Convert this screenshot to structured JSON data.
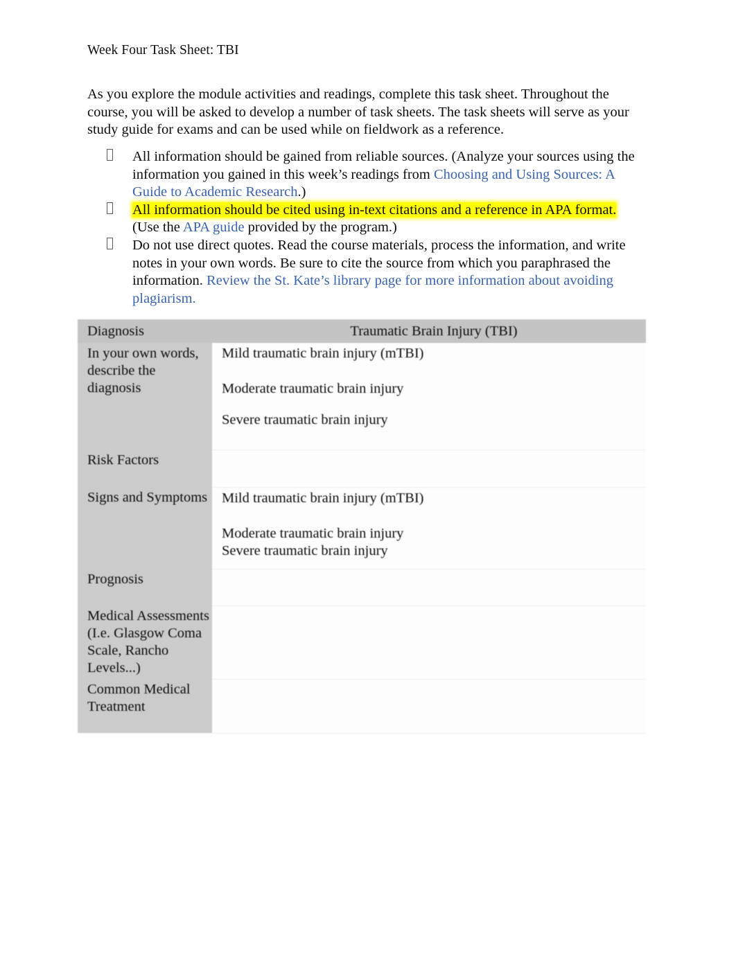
{
  "document": {
    "header": "Week Four Task Sheet: TBI",
    "intro": "As you explore the module activities and readings, complete this task sheet. Throughout the course, you will be asked to develop a number of task sheets. The task sheets will serve as your study guide for exams and can be used while on fieldwork as a reference.",
    "bullet_marker_glyph": "missing-glyph-box"
  },
  "instructions": [
    {
      "id": "reliable-sources",
      "part1": "All information should be gained from reliable sources. (Analyze your sources using the information you gained in this week’s readings from ",
      "link": "Choosing and Using Sources: A Guide to Academic Research",
      "part2": ".)",
      "highlighted": false
    },
    {
      "id": "apa-citations",
      "highlighted_text": "All information should be cited using in-text citations and a reference in APA format.",
      "part1": " (Use the ",
      "link": "APA guide",
      "part2": " provided by the program.)",
      "highlighted": true
    },
    {
      "id": "no-direct-quotes",
      "part1": "Do not use direct quotes. Read the course materials, process the information, and write notes in your own words. Be sure to cite the source from which you paraphrased the information. ",
      "link": "Review the St. Kate’s library page for more information about avoiding plagiarism.",
      "part2": "",
      "highlighted": false
    }
  ],
  "table": {
    "header": {
      "col1": "Diagnosis",
      "col2": "Traumatic Brain Injury (TBI)"
    },
    "rows": [
      {
        "id": "describe-diagnosis",
        "label": "In your own words, describe the diagnosis",
        "values": [
          "Mild traumatic brain injury (mTBI)",
          "Moderate traumatic brain injury",
          "Severe traumatic brain injury"
        ]
      },
      {
        "id": "risk-factors",
        "label": "Risk Factors",
        "values": []
      },
      {
        "id": "signs-and-symptoms",
        "label": "Signs and Symptoms",
        "values": [
          "Mild traumatic brain injury (mTBI)",
          "Moderate traumatic brain injury",
          "Severe traumatic brain injury"
        ]
      },
      {
        "id": "prognosis",
        "label": "Prognosis",
        "values": []
      },
      {
        "id": "medical-assessments",
        "label": "Medical Assessments (I.e. Glasgow Coma Scale, Rancho Levels...)",
        "values": []
      },
      {
        "id": "common-medical-treatment",
        "label": "Common Medical Treatment",
        "values": []
      }
    ]
  },
  "colors": {
    "link": "#3a63b0",
    "highlight": "#ffff00",
    "header_row": "#c4c4c4",
    "label_column": "#cbcbcb",
    "text": "#0d0d0d"
  }
}
